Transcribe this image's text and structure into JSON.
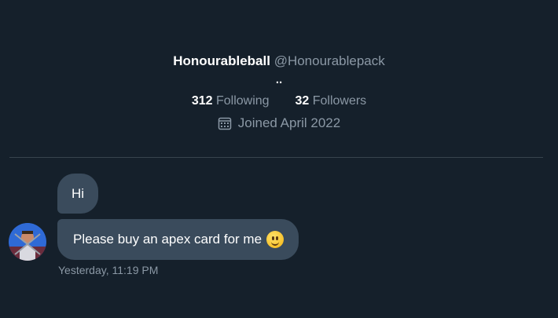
{
  "profile": {
    "display_name": "Honourableball",
    "handle": "@Honourablepack",
    "bio": "..",
    "following_count": "312",
    "following_label": "Following",
    "followers_count": "32",
    "followers_label": "Followers",
    "joined_text": "Joined April 2022",
    "joined_icon": "calendar-icon"
  },
  "messages": [
    {
      "text": "Hi"
    },
    {
      "text": "Please buy an apex card for me",
      "emoji": "slightly-smiling-face-emoji"
    }
  ],
  "message_meta": {
    "timestamp": "Yesterday, 11:19 PM",
    "avatar_icon": "avatar"
  },
  "colors": {
    "background": "#15202b",
    "bubble": "#3a4b5c",
    "secondary_text": "#8b98a5",
    "divider": "#38444d"
  }
}
